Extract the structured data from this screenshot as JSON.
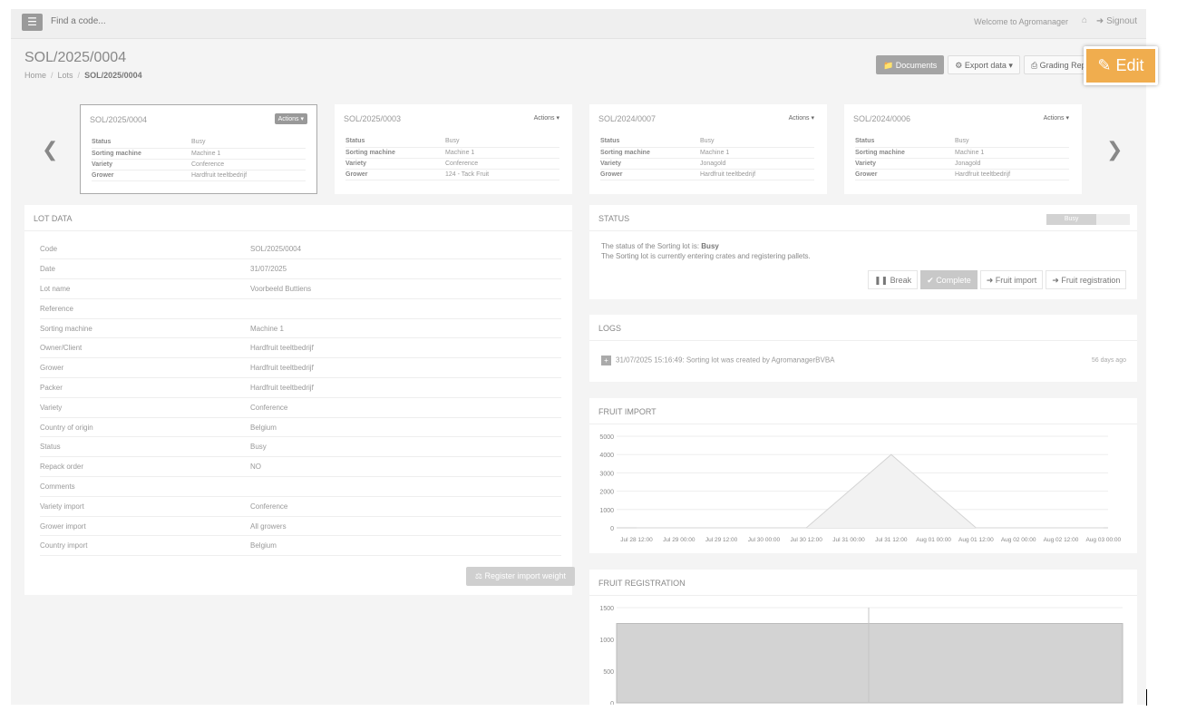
{
  "topbar": {
    "menu_icon": "hamburger-icon",
    "search_placeholder": "Find a code...",
    "welcome": "Welcome to Agromanager",
    "home_icon": "home-icon",
    "signout": "Signout"
  },
  "header": {
    "title": "SOL/2025/0004",
    "breadcrumb": [
      "Home",
      "Lots",
      "SOL/2025/0004"
    ],
    "buttons": {
      "documents": "Documents",
      "export": "Export data",
      "grading": "Grading Rep",
      "edit": "Edit"
    }
  },
  "carousel": {
    "field_labels": [
      "Status",
      "Sorting machine",
      "Variety",
      "Grower"
    ],
    "actions_label": "Actions",
    "cards": [
      {
        "code": "SOL/2025/0004",
        "values": [
          "Busy",
          "Machine 1",
          "Conference",
          "Hardfruit teeltbedrijf"
        ]
      },
      {
        "code": "SOL/2025/0003",
        "values": [
          "Busy",
          "Machine 1",
          "Conference",
          "124 - Tack Fruit"
        ]
      },
      {
        "code": "SOL/2024/0007",
        "values": [
          "Busy",
          "Machine 1",
          "Jonagold",
          "Hardfruit teeltbedrijf"
        ]
      },
      {
        "code": "SOL/2024/0006",
        "values": [
          "Busy",
          "Machine 1",
          "Jonagold",
          "Hardfruit teeltbedrijf"
        ]
      }
    ]
  },
  "lot_data": {
    "title": "LOT DATA",
    "rows": [
      [
        "Code",
        "SOL/2025/0004"
      ],
      [
        "Date",
        "31/07/2025"
      ],
      [
        "Lot name",
        "Voorbeeld Buttiens"
      ],
      [
        "Reference",
        ""
      ],
      [
        "Sorting machine",
        "Machine 1"
      ],
      [
        "Owner/Client",
        "Hardfruit teeltbedrijf"
      ],
      [
        "Grower",
        "Hardfruit teeltbedrijf"
      ],
      [
        "Packer",
        "Hardfruit teeltbedrijf"
      ],
      [
        "Variety",
        "Conference"
      ],
      [
        "Country of origin",
        "Belgium"
      ],
      [
        "Status",
        "Busy"
      ],
      [
        "Repack order",
        "NO"
      ],
      [
        "Comments",
        ""
      ],
      [
        "Variety import",
        "Conference"
      ],
      [
        "Grower import",
        "All growers"
      ],
      [
        "Country import",
        "Belgium"
      ]
    ],
    "register_button": "Register import weight"
  },
  "status": {
    "title": "STATUS",
    "badge": "Busy",
    "progress": 0.6,
    "line1_prefix": "The status of the Sorting lot is: ",
    "line1_value": "Busy",
    "line2": "The Sorting lot is currently entering crates and registering pallets.",
    "buttons": [
      "Break",
      "Complete",
      "Fruit import",
      "Fruit registration"
    ]
  },
  "logs": {
    "title": "LOGS",
    "entries": [
      {
        "text": "31/07/2025 15:16:49: Sorting lot was created by AgromanagerBVBA",
        "ago": "56 days ago"
      }
    ]
  },
  "fruit_import": {
    "title": "FRUIT IMPORT",
    "chart_data": {
      "type": "area",
      "x": [
        "Jul 28 12:00",
        "Jul 29 00:00",
        "Jul 29 12:00",
        "Jul 30 00:00",
        "Jul 30 12:00",
        "Jul 31 00:00",
        "Jul 31 12:00",
        "Aug 01 00:00",
        "Aug 01 12:00",
        "Aug 02 00:00",
        "Aug 02 12:00",
        "Aug 03 00:00"
      ],
      "values": [
        0,
        0,
        0,
        0,
        0,
        2000,
        4000,
        2000,
        0,
        0,
        0,
        0
      ],
      "yticks": [
        0,
        1000,
        2000,
        3000,
        4000,
        5000
      ],
      "ylim": [
        0,
        5000
      ],
      "grid": true
    }
  },
  "fruit_registration": {
    "title": "FRUIT REGISTRATION",
    "chart_data": {
      "type": "bar",
      "values": [
        1250
      ],
      "yticks": [
        0,
        500,
        1000,
        1500
      ],
      "ylim": [
        0,
        1500
      ],
      "grid": true
    }
  }
}
